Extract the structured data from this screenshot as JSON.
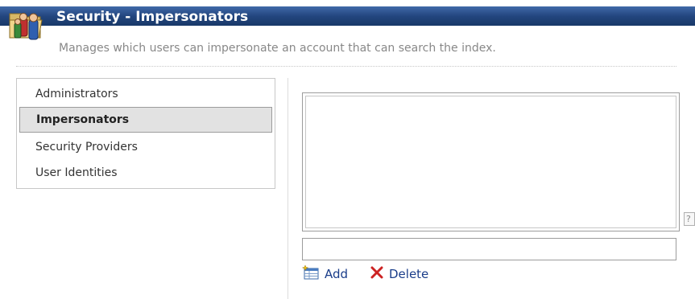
{
  "header": {
    "title": "Security - Impersonators",
    "subtitle": "Manages which users can impersonate an account that can search the index.",
    "icon": "security-folder-icon"
  },
  "sidebar": {
    "items": [
      {
        "label": "Administrators",
        "selected": false
      },
      {
        "label": "Impersonators",
        "selected": true
      },
      {
        "label": "Security Providers",
        "selected": false
      },
      {
        "label": "User Identities",
        "selected": false
      }
    ]
  },
  "main": {
    "impersonators_list": [],
    "help_label": "?",
    "input_value": "",
    "actions": {
      "add_label": "Add",
      "add_icon": "add-table-icon",
      "delete_label": "Delete",
      "delete_icon": "delete-x-icon"
    }
  },
  "colors": {
    "title_bar": "#23467f",
    "link_text": "#1a3d8a",
    "delete_x": "#cc2222",
    "selected_bg": "#e2e2e2"
  }
}
